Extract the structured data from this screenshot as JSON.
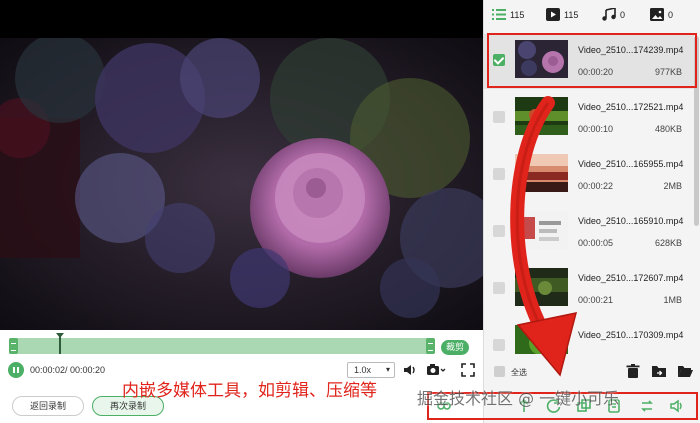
{
  "tabs": [
    {
      "icon": "list-icon",
      "count": "115"
    },
    {
      "icon": "video-icon",
      "count": "115"
    },
    {
      "icon": "music-icon",
      "count": "0"
    },
    {
      "icon": "image-icon",
      "count": "0"
    }
  ],
  "files": [
    {
      "name": "Video_2510...174239.mp4",
      "duration": "00:00:20",
      "size": "977KB",
      "selected": true
    },
    {
      "name": "Video_2510...172521.mp4",
      "duration": "00:00:10",
      "size": "480KB",
      "selected": false
    },
    {
      "name": "Video_2510...165955.mp4",
      "duration": "00:00:22",
      "size": "2MB",
      "selected": false
    },
    {
      "name": "Video_2510...165910.mp4",
      "duration": "00:00:05",
      "size": "628KB",
      "selected": false
    },
    {
      "name": "Video_2510...172607.mp4",
      "duration": "00:00:21",
      "size": "1MB",
      "selected": false
    },
    {
      "name": "Video_2510...170309.mp4",
      "duration": "",
      "size": "",
      "selected": false
    }
  ],
  "player": {
    "cut_label": "裁剪",
    "timecode": "00:00:02/ 00:00:20",
    "speed": "1.0x",
    "progress": 0.1
  },
  "buttons": {
    "back": "返回录制",
    "again": "再次录制"
  },
  "panel_footer": {
    "select_all": "全选"
  },
  "annotation": "内嵌多媒体工具，如剪辑、压缩等",
  "watermark": "掘金技术社区 @ 一键小可乐",
  "colors": {
    "accent": "#4caf66",
    "highlight": "#e0241b",
    "timeline": "#a9d8b3"
  }
}
